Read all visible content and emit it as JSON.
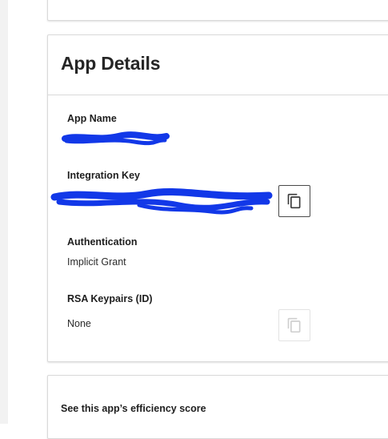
{
  "app_details": {
    "title": "App Details",
    "app_name": {
      "label": "App Name",
      "value_redacted": true
    },
    "integration_key": {
      "label": "Integration Key",
      "value_redacted": true,
      "copy_icon": "copy-icon"
    },
    "authentication": {
      "label": "Authentication",
      "value": "Implicit Grant"
    },
    "rsa_keypairs": {
      "label": "RSA Keypairs (ID)",
      "value": "None",
      "copy_icon": "copy-icon",
      "copy_enabled": false
    }
  },
  "efficiency": {
    "label": "See this app’s efficiency score"
  },
  "colors": {
    "redaction": "#1238e8",
    "border": "#d9d9d9",
    "icon_active": "#3c3c3c",
    "icon_disabled": "#cfcfcf"
  }
}
